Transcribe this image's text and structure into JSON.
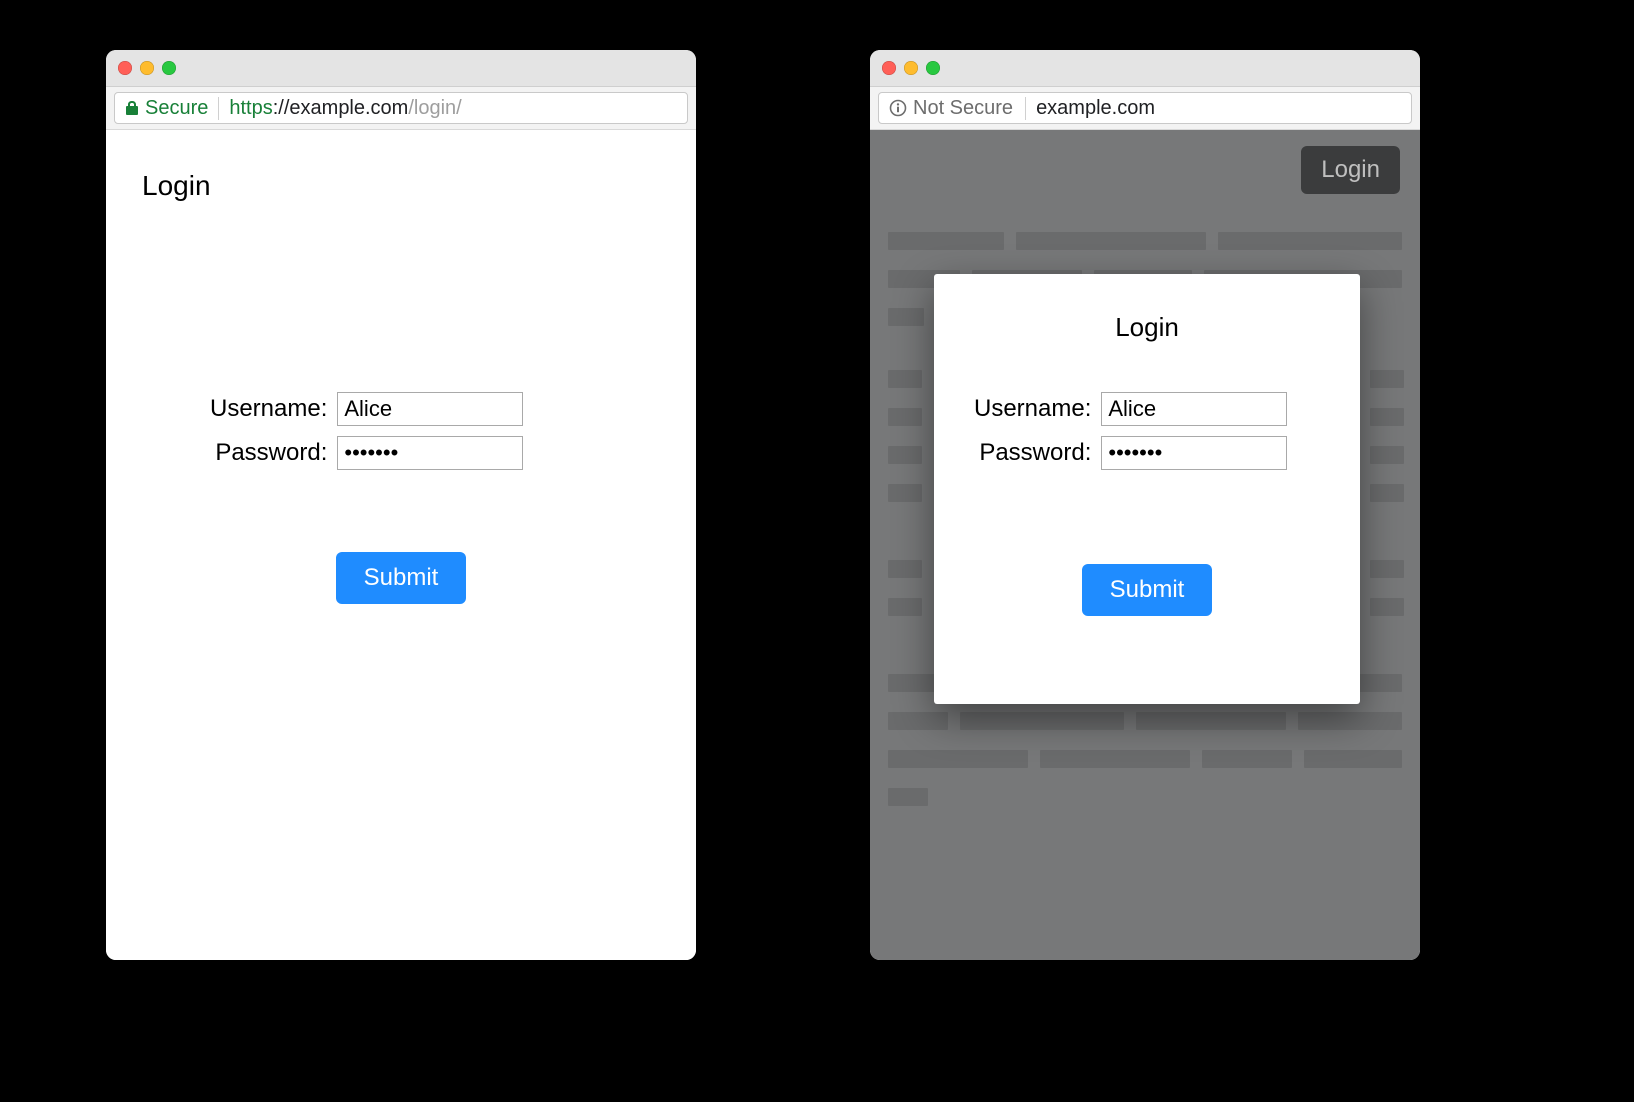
{
  "windowA": {
    "security_label": "Secure",
    "url_scheme": "https",
    "url_host": "example.com",
    "url_path": "/login/",
    "page_title": "Login",
    "form": {
      "username_label": "Username:",
      "username_value": "Alice",
      "password_label": "Password:",
      "password_value": "•••••••",
      "submit_label": "Submit"
    }
  },
  "windowB": {
    "security_label": "Not Secure",
    "url_host": "example.com",
    "header_login_label": "Login",
    "modal": {
      "title": "Login",
      "username_label": "Username:",
      "username_value": "Alice",
      "password_label": "Password:",
      "password_value": "•••••••",
      "submit_label": "Submit"
    }
  },
  "colors": {
    "secure_green": "#188038",
    "button_blue": "#1f8cff",
    "skeleton_bg": "#777879",
    "skeleton_bar": "#6a6b6c"
  }
}
